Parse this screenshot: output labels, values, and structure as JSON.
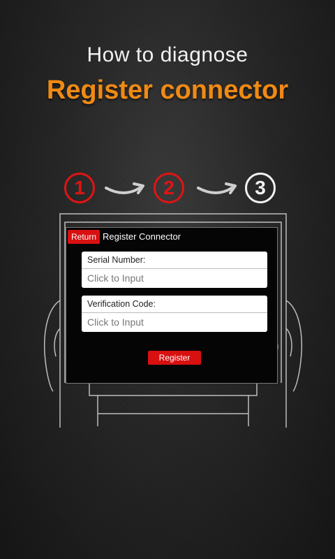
{
  "header": {
    "subtitle": "How to diagnose",
    "title": "Register connector"
  },
  "steps": [
    {
      "number": "1",
      "state": "done",
      "color": "#e01414"
    },
    {
      "number": "2",
      "state": "done",
      "color": "#e01414"
    },
    {
      "number": "3",
      "state": "current",
      "color": "#f2f2f2"
    }
  ],
  "device_screen": {
    "return_label": "Return",
    "title": "Register Connector",
    "serial_field": {
      "label": "Serial Number:",
      "placeholder": "Click to Input"
    },
    "verification_field": {
      "label": "Verification Code:",
      "placeholder": "Click to Input"
    },
    "register_label": "Register"
  },
  "colors": {
    "accent_orange": "#f08a14",
    "accent_red": "#d81010"
  }
}
